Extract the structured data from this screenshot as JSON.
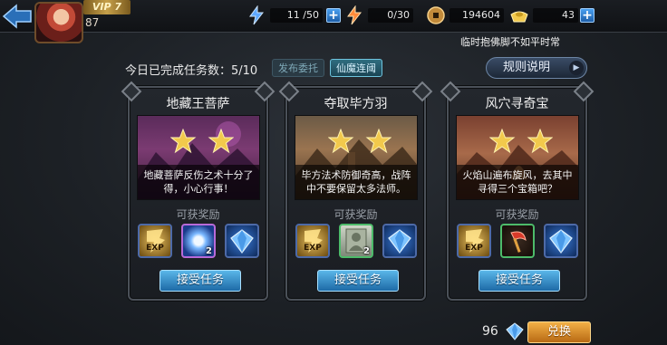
{
  "header": {
    "vip": "VIP 7",
    "level": "87",
    "stamina": "11 /50",
    "vitality": "0/30",
    "coins": "194604",
    "gold": "43",
    "ticker": "临时抱佛脚不如平时常"
  },
  "tasks": {
    "done_label": "今日已完成任务数：5/10",
    "post_label": "发布委托",
    "xm_label": "仙魔连阈",
    "rules_label": "规则说明",
    "reward_label": "可获奖励",
    "accept_label": "接受任务"
  },
  "cards": [
    {
      "title": "地藏王菩萨",
      "desc": "地藏菩萨反伤之术十分了得，小心行事！",
      "stars": 2,
      "rewards": [
        {
          "icon": "exp-icon",
          "label": "EXP"
        },
        {
          "icon": "spirit-orb-icon",
          "qty": "2"
        },
        {
          "icon": "blue-gem-icon"
        }
      ]
    },
    {
      "title": "夺取毕方羽",
      "desc": "毕方法术防御奇高，战阵中不要保留太多法师。",
      "stars": 2,
      "rewards": [
        {
          "icon": "exp-icon",
          "label": "EXP"
        },
        {
          "icon": "hero-card-icon",
          "qty": "2"
        },
        {
          "icon": "blue-gem-icon"
        }
      ]
    },
    {
      "title": "风穴寻奇宝",
      "desc": "火焰山遍布旋风，去其中寻得三个宝箱吧？",
      "stars": 2,
      "rewards": [
        {
          "icon": "exp-icon",
          "label": "EXP"
        },
        {
          "icon": "red-axe-icon"
        },
        {
          "icon": "blue-gem-icon"
        }
      ]
    }
  ],
  "footer": {
    "gem_count": "96",
    "exchange_label": "兑换"
  },
  "colors": {
    "accent_blue": "#1d6aa6",
    "accent_orange": "#b86a14",
    "star_gold": "#f2c94c"
  }
}
